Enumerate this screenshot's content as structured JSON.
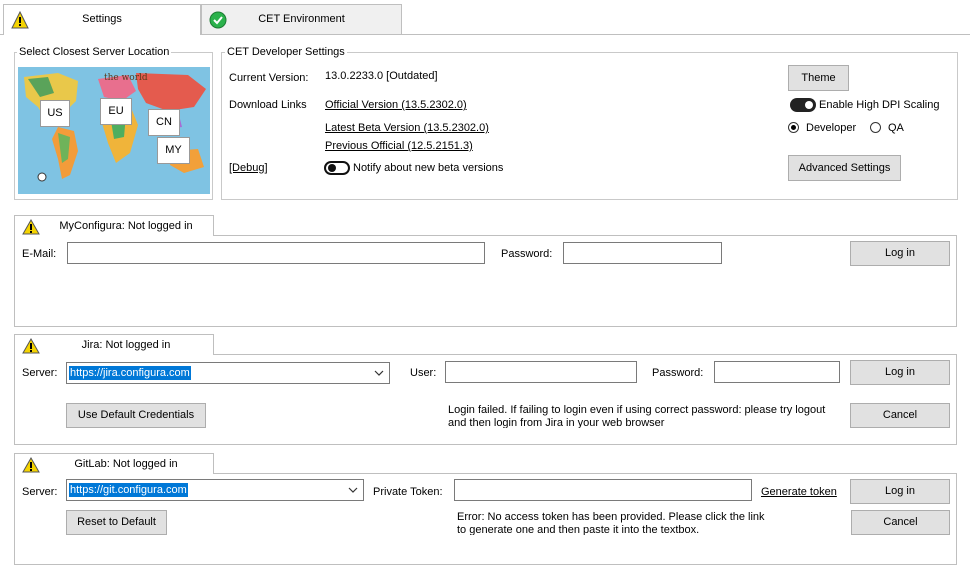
{
  "tabs": [
    {
      "label": "Settings",
      "icon": "warning-icon"
    },
    {
      "label": "CET Environment",
      "icon": "check-icon"
    }
  ],
  "server_location": {
    "legend": "Select Closest Server Location",
    "map_title": "the world",
    "regions": [
      "US",
      "EU",
      "CN",
      "MY"
    ]
  },
  "dev_settings": {
    "legend": "CET Developer Settings",
    "current_version_label": "Current Version:",
    "current_version_value": "13.0.2233.0 [Outdated]",
    "download_links_label": "Download Links",
    "links": [
      "Official Version (13.5.2302.0)",
      "Latest Beta Version (13.5.2302.0)",
      "Previous Official (12.5.2151.3)"
    ],
    "debug_label": "[Debug]",
    "notify_label": "Notify about new beta versions",
    "theme_button": "Theme",
    "high_dpi_label": "Enable High DPI Scaling",
    "mode_options": [
      "Developer",
      "QA"
    ],
    "advanced_button": "Advanced Settings"
  },
  "myconfigura": {
    "status": "MyConfigura: Not logged in",
    "email_label": "E-Mail:",
    "password_label": "Password:",
    "login_button": "Log in"
  },
  "jira": {
    "status": "Jira: Not logged in",
    "server_label": "Server:",
    "server_value": "https://jira.configura.com",
    "user_label": "User:",
    "password_label": "Password:",
    "login_button": "Log in",
    "default_creds_button": "Use Default Credentials",
    "message": "Login failed. If failing to login even if using correct password: please try logout and then login from Jira in your web browser",
    "cancel_button": "Cancel"
  },
  "gitlab": {
    "status": "GitLab: Not logged in",
    "server_label": "Server:",
    "server_value": "https://git.configura.com",
    "token_label": "Private Token:",
    "generate_link": "Generate token",
    "login_button": "Log in",
    "reset_button": "Reset to Default",
    "message": "Error: No access token has been provided. Please click the link to generate one and then paste it into the textbox.",
    "cancel_button": "Cancel"
  },
  "colors": {
    "warning": "#f5d400",
    "success": "#2bb24c",
    "selection": "#0078d7"
  }
}
